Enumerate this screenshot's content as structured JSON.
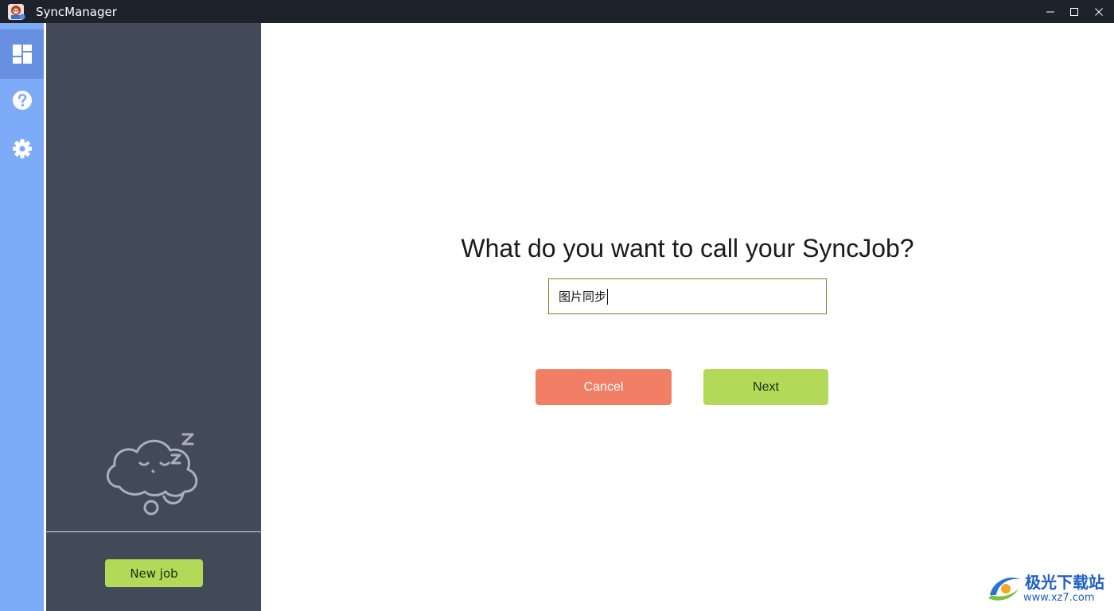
{
  "window": {
    "title": "SyncManager",
    "controls": [
      "minimize-icon",
      "maximize-icon",
      "close-icon"
    ]
  },
  "rail": {
    "items": [
      {
        "icon": "dashboard-icon",
        "active": true
      },
      {
        "icon": "help-icon",
        "active": false
      },
      {
        "icon": "gear-icon",
        "active": false
      }
    ]
  },
  "job_panel": {
    "empty_illustration": "sleeping-cloud-icon",
    "new_job_label": "New job"
  },
  "wizard": {
    "question": "What do you want to call your SyncJob?",
    "name_value": "图片同步",
    "cancel_label": "Cancel",
    "next_label": "Next"
  },
  "watermark": {
    "line1": "极光下载站",
    "line2": "www.xz7.com"
  },
  "colors": {
    "titlebar": "#1d222b",
    "rail": "#7eabf8",
    "rail_active": "#6790e0",
    "panel": "#424a57",
    "cancel": "#f17f65",
    "next": "#b2d957",
    "input_border": "#6e8a2a"
  }
}
